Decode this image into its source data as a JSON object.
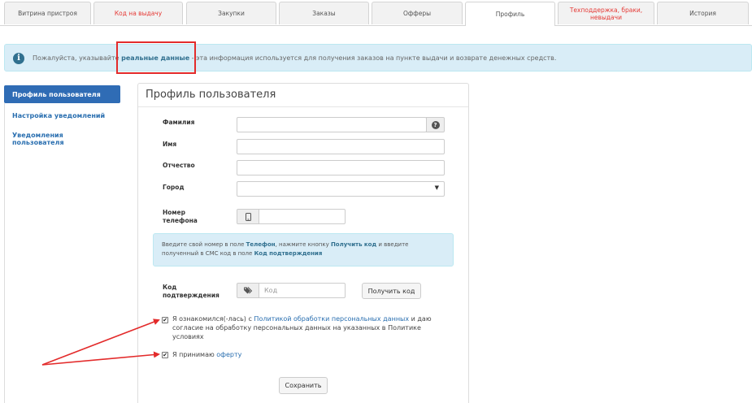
{
  "tabs": [
    {
      "label": "Витрина пристроя"
    },
    {
      "label": "Код на выдачу"
    },
    {
      "label": "Закупки"
    },
    {
      "label": "Заказы"
    },
    {
      "label": "Офферы"
    },
    {
      "label": "Профиль"
    },
    {
      "label": "Техподдержка, браки, невыдачи"
    },
    {
      "label": "История"
    }
  ],
  "alert": {
    "prefix": "Пожалуйста, указывайте",
    "bold": "реальные данные",
    "suffix": "- эта информация используется для получения заказов на пункте выдачи и возврате денежных средств."
  },
  "sidebar": {
    "items": [
      {
        "label": "Профиль пользователя"
      },
      {
        "label": "Настройка уведомлений"
      },
      {
        "label": "Уведомления пользователя"
      }
    ]
  },
  "form": {
    "title": "Профиль пользователя",
    "surname_label": "Фамилия",
    "name_label": "Имя",
    "patronymic_label": "Отчество",
    "city_label": "Город",
    "phone_label_1": "Номер",
    "phone_label_2": "телефона",
    "info": {
      "t1": "Введите свой номер в поле ",
      "b1": "Телефон",
      "t2": ", нажмите кнопку ",
      "b2": "Получить код",
      "t3": " и введите полученный в СМС код в поле ",
      "b3": "Код подтверждения"
    },
    "code_label_1": "Код",
    "code_label_2": "подтверждения",
    "code_placeholder": "Код",
    "get_code_button": "Получить код",
    "consent": {
      "t1": "Я ознакомился(-лась) с ",
      "link": "Политикой обработки персональных данных",
      "t2": " и даю",
      "line2": "согласие на обработку персональных данных на указанных в Политике",
      "line3": "условиях"
    },
    "offer": {
      "t1": "Я принимаю ",
      "link": "оферту"
    },
    "save_button": "Сохранить"
  },
  "colors": {
    "accent": "#2f6cb5",
    "alert_bg": "#d9edf7",
    "annotation": "#e32b2b"
  }
}
